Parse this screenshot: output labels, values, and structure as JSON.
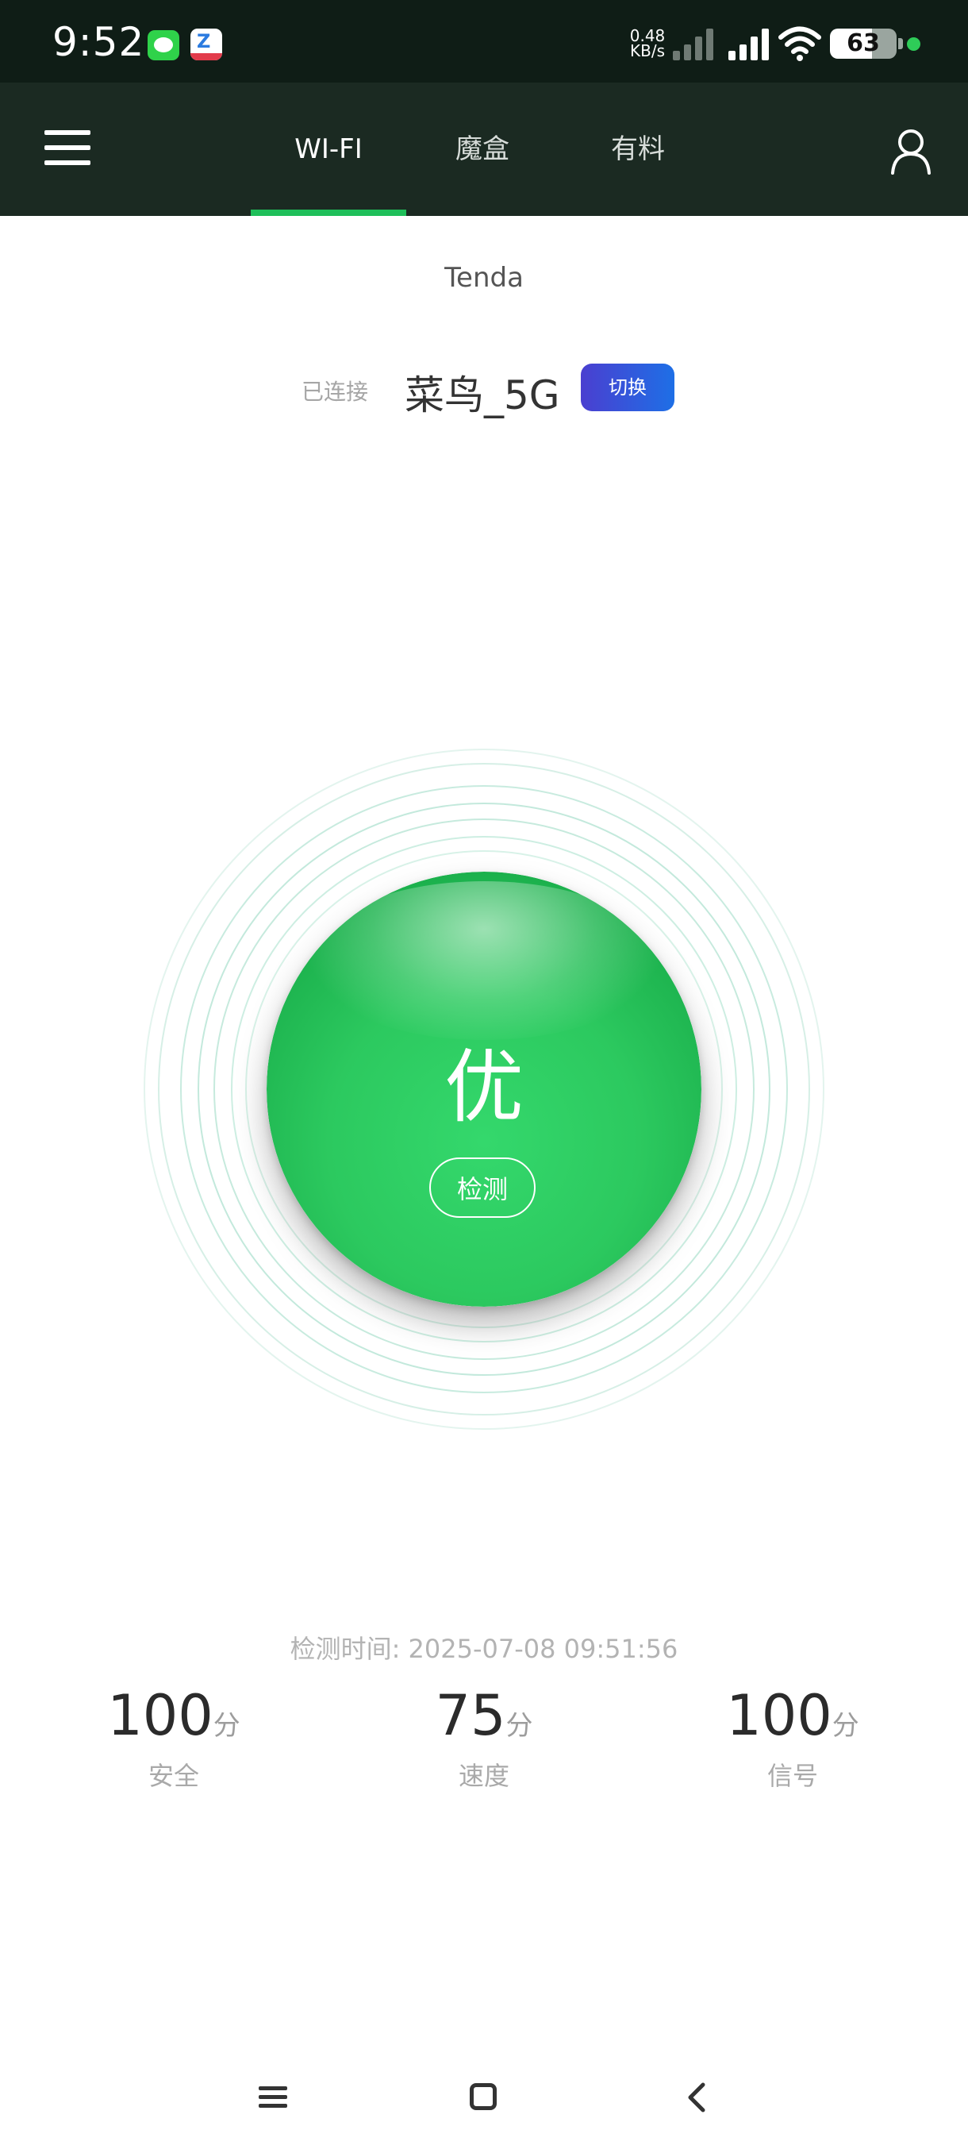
{
  "status_bar": {
    "time": "9:52",
    "net_speed_value": "0.48",
    "net_speed_unit": "KB/s",
    "battery_level": "63",
    "icons": [
      "message-app-icon",
      "z-app-icon",
      "signal-icon",
      "signal-icon",
      "wifi-icon",
      "battery-icon",
      "charging-dot"
    ],
    "charge_dot_color": "#2ecc58"
  },
  "header": {
    "menu_icon": "hamburger-menu-icon",
    "tabs": [
      {
        "label": "WI-FI",
        "active": true
      },
      {
        "label": "魔盒",
        "active": false
      },
      {
        "label": "有料",
        "active": false
      }
    ],
    "user_icon": "user-icon"
  },
  "router": {
    "name": "Tenda",
    "connected_label": "已连接",
    "ssid": "菜鸟_5G",
    "switch_label": "切换"
  },
  "status": {
    "grade": "优",
    "detect_label": "检测"
  },
  "result": {
    "detect_time": "检测时间: 2025-07-08 09:51:56",
    "scores": [
      {
        "value": "100",
        "unit": "分",
        "label": "安全"
      },
      {
        "value": "75",
        "unit": "分",
        "label": "速度"
      },
      {
        "value": "100",
        "unit": "分",
        "label": "信号"
      }
    ]
  },
  "nav_bar": {
    "icons": [
      "recent-apps-icon",
      "home-icon",
      "back-icon"
    ]
  },
  "colors": {
    "status_bar_bg": "#0f1d16",
    "header_bg": "#1b2a22",
    "accent_green": "#1fbf5a",
    "switch_gradient_start": "#4a3fd0",
    "switch_gradient_end": "#1e6fe6",
    "ring_color": "#bfe8dc"
  }
}
